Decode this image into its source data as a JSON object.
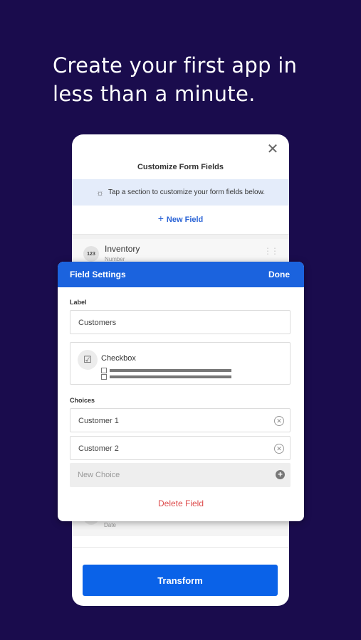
{
  "headline": "Create your first app in less than a minute.",
  "customize": {
    "title": "Customize Form Fields",
    "tip": "Tap a section to customize your form fields below.",
    "new_field": "New Field",
    "close_icon": "close-icon",
    "fields": [
      {
        "name": "Inventory",
        "type": "Number",
        "badge": "123"
      },
      {
        "type": "Date"
      }
    ],
    "transform_label": "Transform"
  },
  "field_settings": {
    "title": "Field Settings",
    "done": "Done",
    "label_heading": "Label",
    "label_value": "Customers",
    "type_name": "Checkbox",
    "choices_heading": "Choices",
    "choices": [
      "Customer 1",
      "Customer 2"
    ],
    "new_choice_placeholder": "New Choice",
    "delete_label": "Delete Field"
  },
  "colors": {
    "background": "#1a0c4d",
    "accent": "#1b63de",
    "button": "#0a62e8",
    "danger": "#dd4b4b"
  }
}
